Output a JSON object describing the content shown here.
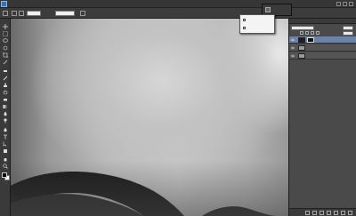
{
  "app": {
    "logo_text": "Ps"
  },
  "menubar": {
    "items": [
      "",
      "",
      "",
      "",
      "",
      "",
      "",
      "",
      "",
      "",
      "",
      ""
    ],
    "workspace_label": ""
  },
  "options": {
    "field1": "",
    "field2": "",
    "label1": ""
  },
  "dropdown": {
    "items": [
      {
        "label": ""
      },
      {
        "label": ""
      }
    ]
  },
  "dock": {
    "items": [
      {
        "label": ""
      },
      {
        "label": ""
      }
    ]
  },
  "layers_panel": {
    "tabs": [
      "",
      "",
      ""
    ],
    "blend_mode": "",
    "opacity_label": "",
    "opacity_value": "",
    "lock_label": "",
    "fill_label": "",
    "fill_value": "",
    "layers": [
      {
        "name": "",
        "selected": true,
        "has_mask": true,
        "thumb_dark": true
      },
      {
        "name": "",
        "selected": false,
        "has_mask": false,
        "thumb_dark": false
      },
      {
        "name": "",
        "selected": false,
        "has_mask": false,
        "thumb_dark": false
      }
    ]
  },
  "colors": {
    "selected_layer": "#6b83a8",
    "ui_dark": "#3a3a3a",
    "foreground_swatch": "#000000",
    "background_swatch": "#ffffff"
  },
  "icons": {
    "tools": [
      "move-icon",
      "marquee-icon",
      "lasso-icon",
      "quick-select-icon",
      "crop-icon",
      "eyedropper-icon",
      "healing-icon",
      "brush-icon",
      "clone-stamp-icon",
      "history-brush-icon",
      "eraser-icon",
      "gradient-icon",
      "blur-icon",
      "dodge-icon",
      "pen-icon",
      "type-icon",
      "path-select-icon",
      "shape-icon",
      "hand-icon",
      "zoom-icon"
    ]
  }
}
